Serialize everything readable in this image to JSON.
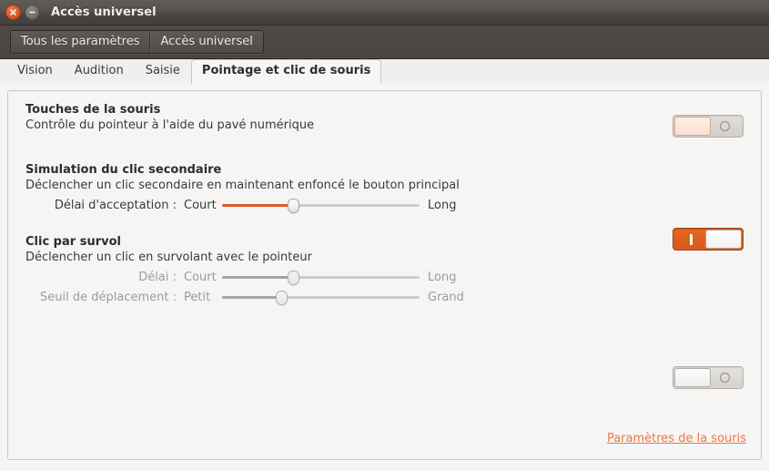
{
  "window": {
    "title": "Accès universel",
    "close_icon": "close-icon",
    "minimize_icon": "minimize-icon"
  },
  "toolbar": {
    "all_settings_label": "Tous les paramètres",
    "current_panel_label": "Accès universel"
  },
  "tabs": [
    {
      "label": "Vision",
      "active": false
    },
    {
      "label": "Audition",
      "active": false
    },
    {
      "label": "Saisie",
      "active": false
    },
    {
      "label": "Pointage et clic de souris",
      "active": true
    }
  ],
  "sections": {
    "mouse_keys": {
      "title": "Touches de la souris",
      "description": "Contrôle du pointeur à l'aide du pavé numérique",
      "toggle_state": "off",
      "toggle_glyph": "O"
    },
    "simulated_secondary_click": {
      "title": "Simulation du clic secondaire",
      "description": "Déclencher un clic secondaire en maintenant enfoncé le bouton principal",
      "toggle_state": "on",
      "toggle_glyph": "I",
      "slider": {
        "label": "Délai d'acceptation :",
        "min_label": "Court",
        "max_label": "Long",
        "value_percent": 36,
        "enabled": true
      }
    },
    "hover_click": {
      "title": "Clic par survol",
      "description": "Déclencher un clic en survolant avec le pointeur",
      "toggle_state": "off",
      "toggle_glyph": "O",
      "sliders": [
        {
          "label": "Délai :",
          "min_label": "Court",
          "max_label": "Long",
          "value_percent": 36,
          "enabled": false
        },
        {
          "label": "Seuil de déplacement :",
          "min_label": "Petit",
          "max_label": "Grand",
          "value_percent": 30,
          "enabled": false
        }
      ]
    }
  },
  "footer": {
    "mouse_settings_link": "Paramètres de la souris"
  },
  "colors": {
    "accent_orange": "#dd5a28",
    "link_orange": "#ef7642",
    "titlebar_dark": "#4a4744",
    "panel_bg": "#f6f5f4"
  }
}
